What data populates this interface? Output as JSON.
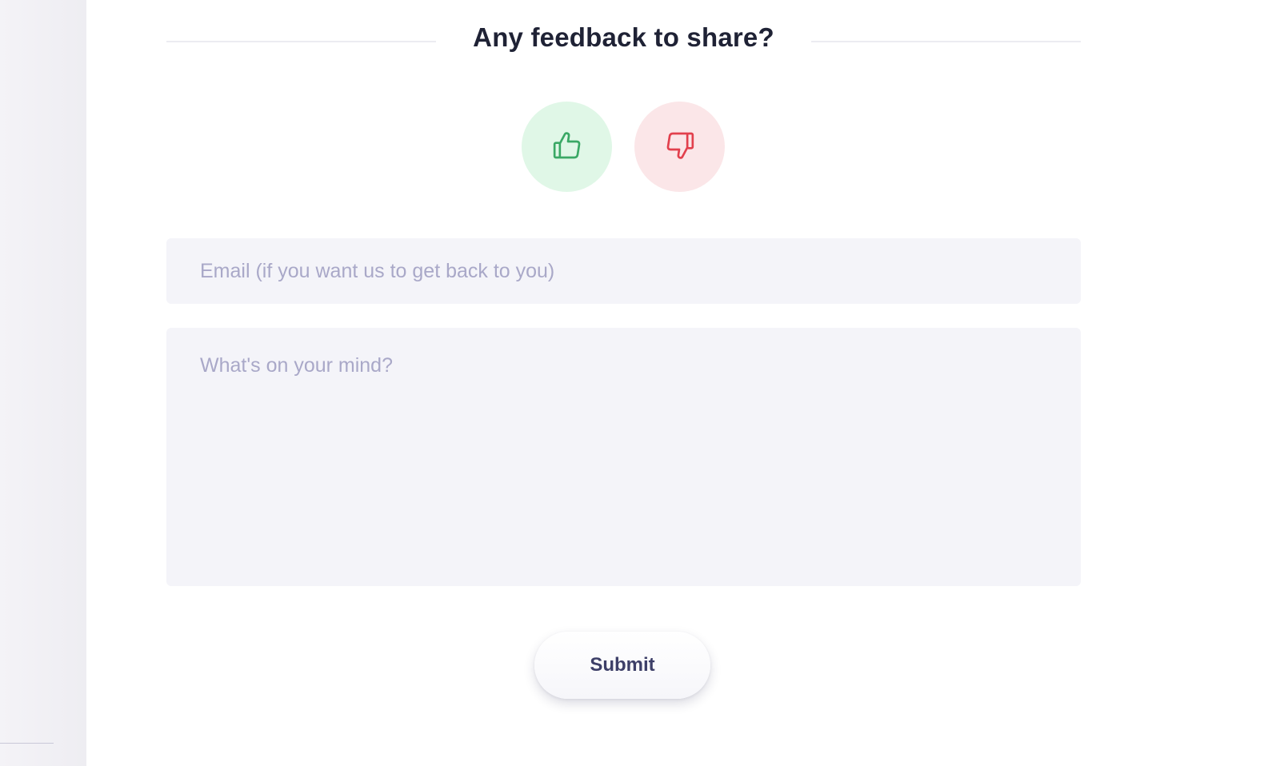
{
  "feedback": {
    "title": "Any feedback to share?",
    "thumbs_up_icon": "thumbs-up-icon",
    "thumbs_down_icon": "thumbs-down-icon",
    "email_placeholder": "Email (if you want us to get back to you)",
    "email_value": "",
    "message_placeholder": "What's on your mind?",
    "message_value": "",
    "submit_label": "Submit"
  },
  "colors": {
    "thumbs_up_bg": "#e0f7e7",
    "thumbs_up_icon": "#3aa865",
    "thumbs_down_bg": "#fbe6e8",
    "thumbs_down_icon": "#e2404d",
    "title_text": "#1f2235",
    "placeholder_text": "#a9a8c8",
    "field_bg": "#f4f4f9",
    "submit_text": "#3d3f68"
  }
}
